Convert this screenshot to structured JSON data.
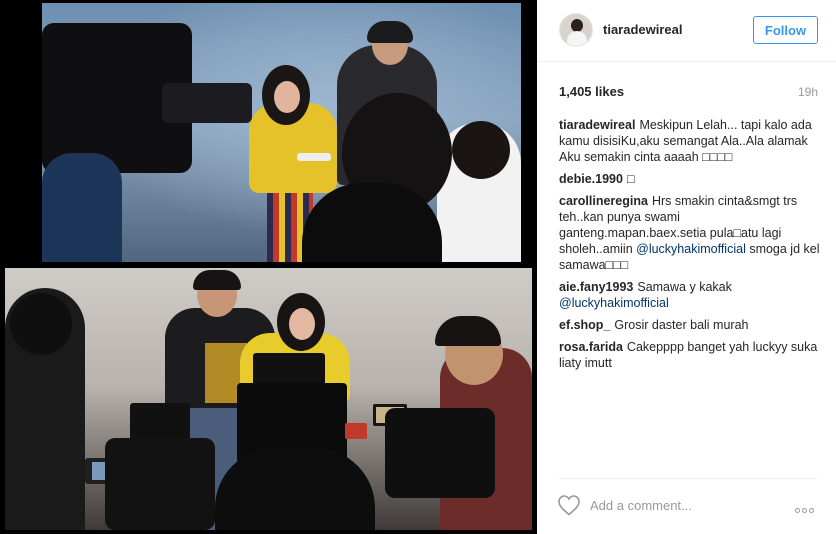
{
  "post": {
    "username": "tiaradewireal",
    "follow_label": "Follow",
    "likes": "1,405 likes",
    "time": "19h"
  },
  "comments": [
    {
      "author": "tiaradewireal",
      "parts": [
        "Meskipun Lelah... tapi kalo ada kamu disisiKu,aku semangat Ala..Ala alamak Aku semakin cinta aaaah □□□□"
      ]
    },
    {
      "author": "debie.1990",
      "parts": [
        "□"
      ]
    },
    {
      "author": "carollineregina",
      "parts": [
        "Hrs smakin cinta&smgt trs teh..kan punya swami ganteng.mapan.baex.setia pula□atu lagi sholeh..amiin ",
        "@luckyhakimofficial",
        " smoga jd kel samawa□□□"
      ]
    },
    {
      "author": "aie.fany1993",
      "parts": [
        "Samawa y kakak ",
        "@luckyhakimofficial"
      ]
    },
    {
      "author": "ef.shop_",
      "parts": [
        "Grosir daster bali murah"
      ]
    },
    {
      "author": "rosa.farida",
      "parts": [
        "Cakepppp banget yah luckyy suka liaty imutt"
      ]
    }
  ],
  "footer": {
    "add_comment_placeholder": "Add a comment..."
  },
  "icons": {
    "like": "heart-outline-icon",
    "more": "more-options-icon"
  },
  "colors": {
    "accent": "#3897f0",
    "mention": "#003569",
    "muted": "#999999"
  }
}
